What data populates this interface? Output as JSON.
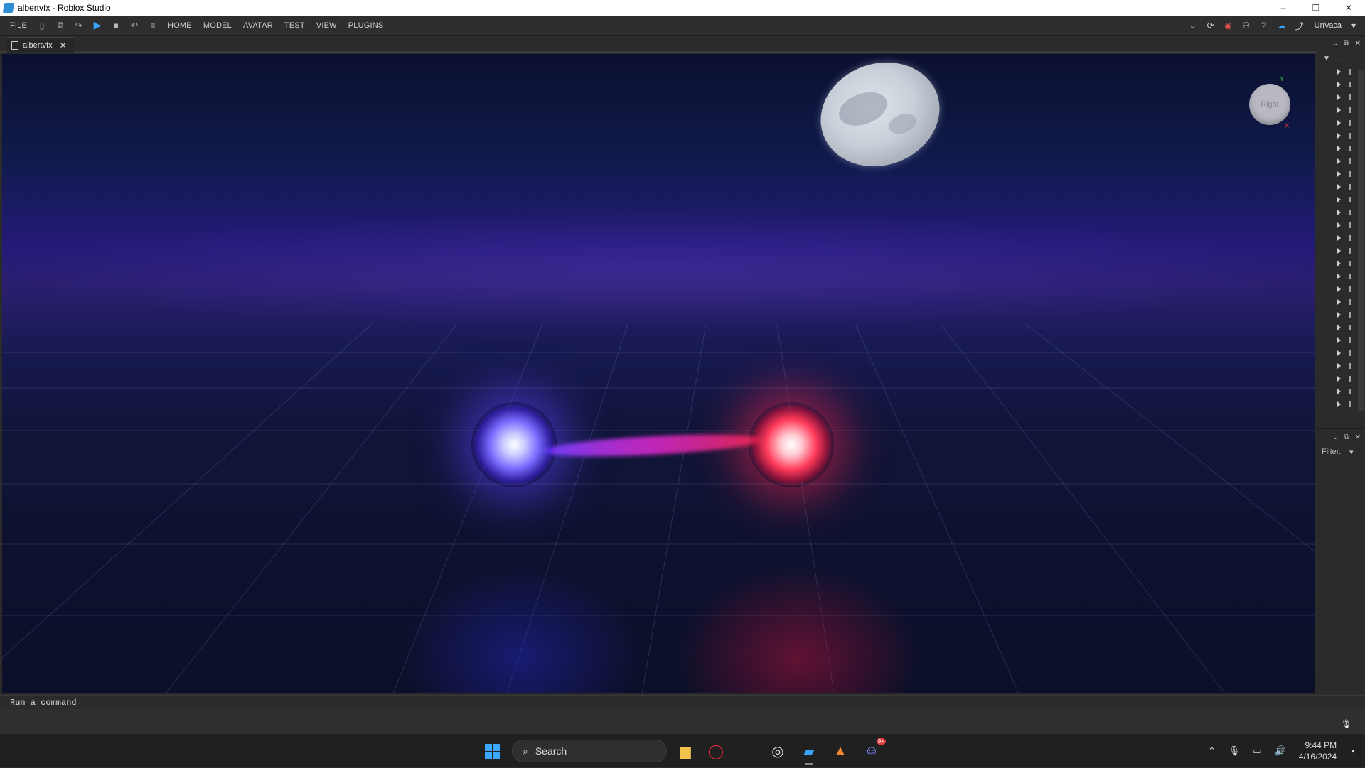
{
  "window": {
    "title": "albertvfx - Roblox Studio",
    "controls": [
      "–",
      "❐",
      "✕"
    ]
  },
  "menu": {
    "items": [
      "FILE",
      "HOME",
      "MODEL",
      "AVATAR",
      "TEST",
      "VIEW",
      "PLUGINS"
    ],
    "user": "UnVaca"
  },
  "tab": {
    "label": "albertvfx",
    "close": "✕"
  },
  "viewport": {
    "viewcube_label": "Right",
    "axis_y": "Y",
    "axis_x": "X"
  },
  "panels": {
    "explorer_filter": "Filter...",
    "tree_rows": 27
  },
  "command": {
    "placeholder": "Run a command"
  },
  "taskbar": {
    "search_label": "Search",
    "time": "9:44 PM",
    "date": "4/16/2024",
    "discord_badge": "9+"
  },
  "colors": {
    "accent": "#3aa4ff",
    "blue_orb": "#7a6cff",
    "red_orb": "#ff3a5a"
  }
}
